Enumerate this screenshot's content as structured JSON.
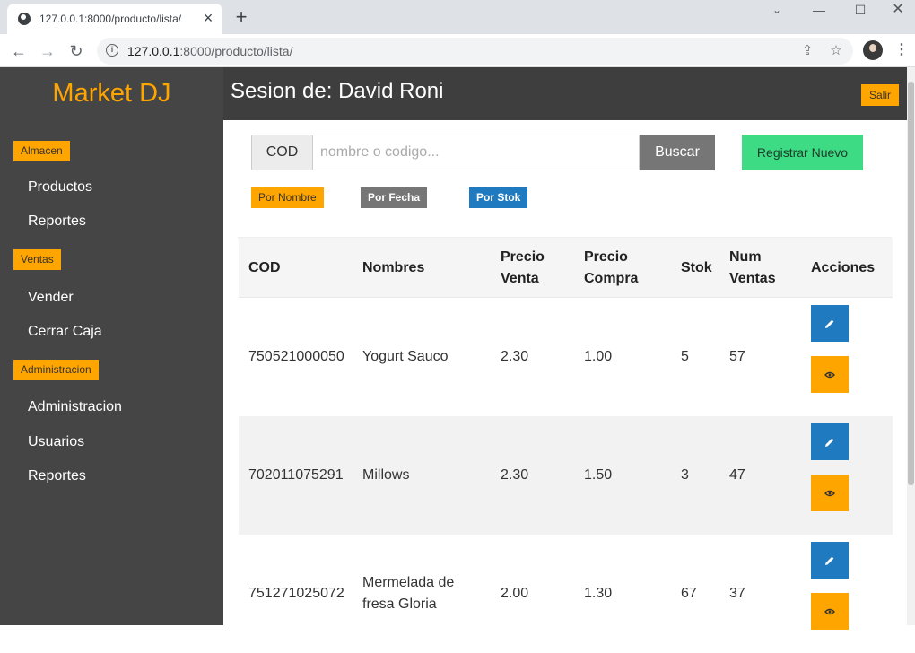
{
  "browser": {
    "tab_title": "127.0.0.1:8000/producto/lista/",
    "url_host": "127.0.0.1",
    "url_rest": ":8000/producto/lista/"
  },
  "sidebar": {
    "brand": "Market DJ",
    "sections": [
      {
        "label": "Almacen",
        "items": [
          "Productos",
          "Reportes"
        ]
      },
      {
        "label": "Ventas",
        "items": [
          "Vender",
          "Cerrar Caja"
        ]
      },
      {
        "label": "Administracion",
        "items": [
          "Administracion",
          "Usuarios",
          "Reportes"
        ]
      }
    ]
  },
  "header": {
    "session": "Sesion de: David Roni",
    "logout_label": "Salir"
  },
  "search": {
    "addon": "COD",
    "placeholder": "nombre o codigo...",
    "button": "Buscar"
  },
  "register_label": "Registrar Nuevo",
  "sort": {
    "by_name": "Por Nombre",
    "by_date": "Por Fecha",
    "by_stock": "Por Stok"
  },
  "table": {
    "headers": [
      "COD",
      "Nombres",
      "Precio Venta",
      "Precio Compra",
      "Stok",
      "Num Ventas",
      "Acciones"
    ],
    "rows": [
      {
        "cod": "750521000050",
        "nombre": "Yogurt Sauco",
        "precio_venta": "2.30",
        "precio_compra": "1.00",
        "stok": "5",
        "num_ventas": "57"
      },
      {
        "cod": "702011075291",
        "nombre": "Millows",
        "precio_venta": "2.30",
        "precio_compra": "1.50",
        "stok": "3",
        "num_ventas": "47"
      },
      {
        "cod": "751271025072",
        "nombre": "Mermelada de fresa Gloria",
        "precio_venta": "2.00",
        "precio_compra": "1.30",
        "stok": "67",
        "num_ventas": "37"
      }
    ]
  },
  "colors": {
    "accent": "#ffa500",
    "sidebar_bg": "#454545",
    "primary_blue": "#1f7abf",
    "success_green": "#3ddc84"
  }
}
